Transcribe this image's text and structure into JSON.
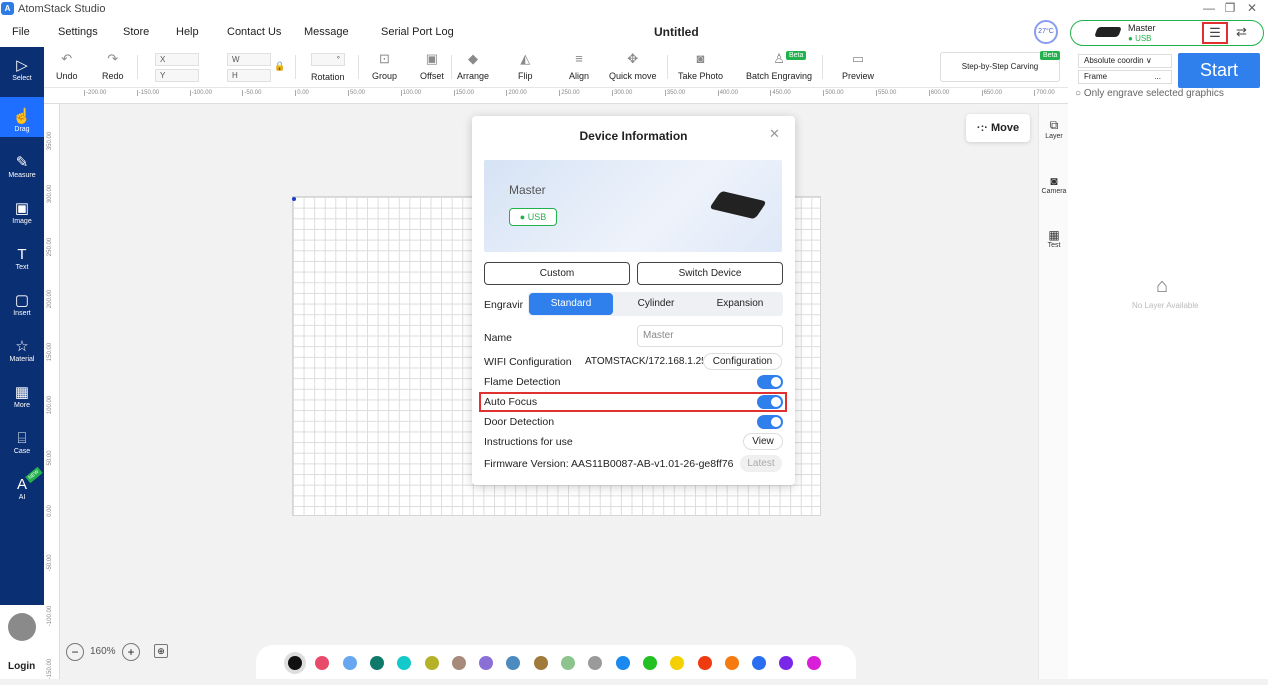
{
  "app": {
    "title": "AtomStack Studio",
    "logo_glyph": "A"
  },
  "menu": {
    "file": "File",
    "settings": "Settings",
    "store": "Store",
    "help": "Help",
    "contact": "Contact Us",
    "message": "Message",
    "serial": "Serial Port Log",
    "doc_title": "Untitled"
  },
  "toolbar": {
    "undo": "Undo",
    "redo": "Redo",
    "x": "X",
    "y": "Y",
    "w": "W",
    "h": "H",
    "deg": "°",
    "rotation": "Rotation",
    "group": "Group",
    "offset": "Offset",
    "arrange": "Arrange",
    "flip": "Flip",
    "align": "Align",
    "quick_move": "Quick move",
    "take_photo": "Take Photo",
    "batch": "Batch Engraving",
    "batch_badge": "Beta",
    "preview": "Preview"
  },
  "ruler": {
    "h": [
      "-200.00",
      "-150.00",
      "-100.00",
      "-50.00",
      "0.00",
      "50.00",
      "100.00",
      "150.00",
      "200.00",
      "250.00",
      "300.00",
      "350.00",
      "400.00",
      "450.00",
      "500.00",
      "550.00",
      "600.00",
      "650.00",
      "700.00"
    ],
    "v": [
      "350.00",
      "300.00",
      "250.00",
      "200.00",
      "150.00",
      "100.00",
      "50.00",
      "0.00",
      "-50.00",
      "-100.00",
      "-150.00"
    ]
  },
  "leftbar": {
    "items": [
      "Select",
      "Drag",
      "Measure",
      "Image",
      "Text",
      "Insert",
      "Material",
      "More",
      "Case",
      "AI"
    ],
    "ai_badge": "NEW",
    "login": "Login"
  },
  "side": {
    "move": "Move",
    "layer": "Layer",
    "camera": "Camera",
    "test": "Test"
  },
  "right": {
    "temp": "27°C",
    "device": "Master",
    "conn": "USB",
    "step_carving": "Step-by-Step Carving",
    "step_badge": "Beta",
    "coord": "Absolute coordin",
    "frame": "Frame",
    "frame_more": "...",
    "start": "Start",
    "only_selected": "Only engrave selected graphics",
    "no_layer": "No Layer Available"
  },
  "dialog": {
    "title": "Device Information",
    "device": "Master",
    "conn": "USB",
    "custom": "Custom",
    "switch": "Switch Device",
    "engrave_label": "Engravir",
    "modes": [
      "Standard",
      "Cylinder",
      "Expansion"
    ],
    "name_label": "Name",
    "name_value": "Master",
    "wifi_label": "WIFI Configuration",
    "wifi_value": "ATOMSTACK/172.168.1.251",
    "config_btn": "Configuration",
    "flame": "Flame Detection",
    "autofocus": "Auto Focus",
    "door": "Door Detection",
    "instructions": "Instructions for use",
    "view": "View",
    "firmware": "Firmware Version: AAS11B0087-AB-v1.01-26-ge8ff76",
    "latest": "Latest"
  },
  "zoom": {
    "value": "160%",
    "minus": "−",
    "plus": "+"
  },
  "palette": [
    "#111111",
    "#e84a6a",
    "#67a7f0",
    "#0f7a6a",
    "#14c9c9",
    "#b5b22a",
    "#a78a7a",
    "#8a6fd6",
    "#4d8abf",
    "#a07a3a",
    "#8dc48d",
    "#9a9a9a",
    "#1a8af0",
    "#22c022",
    "#f5d000",
    "#f03a10",
    "#f57a10",
    "#2b6ff0",
    "#7a28e8",
    "#d81ed8"
  ]
}
